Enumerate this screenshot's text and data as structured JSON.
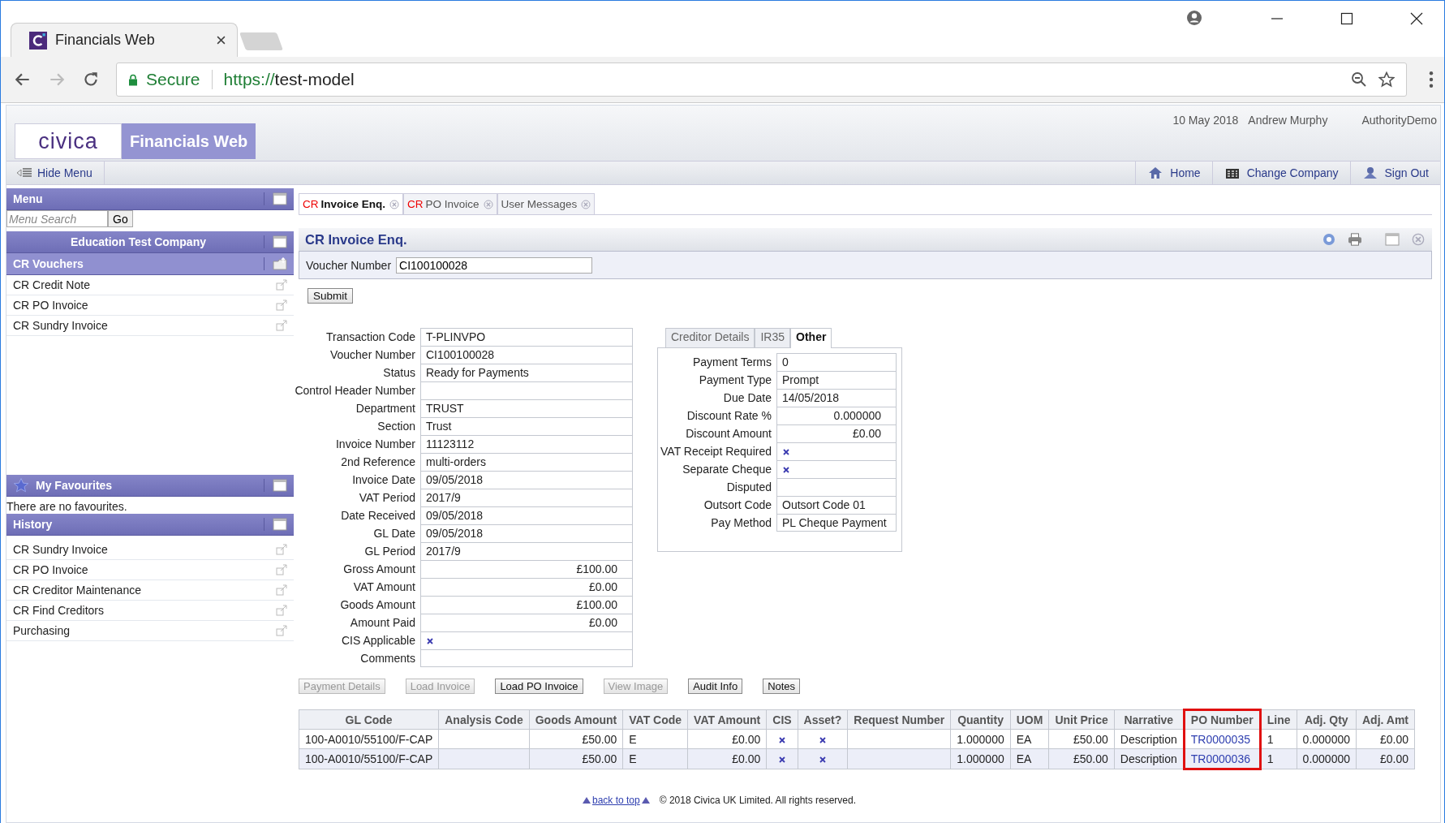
{
  "browser": {
    "tab_title": "Financials Web",
    "secure_label": "Secure",
    "url_scheme": "https://",
    "url_host": "test-model"
  },
  "header": {
    "logo": "civica",
    "product": "Financials Web",
    "date": "10 May 2018",
    "user": "Andrew Murphy",
    "company": "AuthorityDemo"
  },
  "nav": {
    "hide_menu": "Hide Menu",
    "links": [
      {
        "kind": "home",
        "label": "Home"
      },
      {
        "kind": "company",
        "label": "Change Company"
      },
      {
        "kind": "signout",
        "label": "Sign Out"
      }
    ]
  },
  "sidebar": {
    "menu_title": "Menu",
    "search_placeholder": "Menu Search",
    "go": "Go",
    "company": "Education Test Company",
    "section": {
      "title": "CR Vouchers",
      "items": [
        "CR Credit Note",
        "CR PO Invoice",
        "CR Sundry Invoice"
      ]
    },
    "favourites": {
      "title": "My Favourites",
      "empty": "There are no favourites."
    },
    "history": {
      "title": "History",
      "items": [
        "CR Sundry Invoice",
        "CR PO Invoice",
        "CR Creditor Maintenance",
        "CR Find Creditors",
        "Purchasing"
      ]
    }
  },
  "tabs": [
    {
      "prefix": "CR",
      "label": "Invoice Enq.",
      "selected": true
    },
    {
      "prefix": "CR",
      "label": "PO Invoice",
      "selected": false
    },
    {
      "label": "User Messages",
      "selected": false
    }
  ],
  "page_title": "CR Invoice Enq.",
  "voucher": {
    "label": "Voucher Number",
    "value": "CI100100028"
  },
  "submit": "Submit",
  "fields": [
    {
      "label": "Transaction Code",
      "kind": "text",
      "value": "T-PLINVPO"
    },
    {
      "label": "Voucher Number",
      "kind": "text",
      "value": "CI100100028"
    },
    {
      "label": "Status",
      "kind": "text",
      "value": "Ready for Payments"
    },
    {
      "label": "Control Header Number",
      "kind": "text"
    },
    {
      "label": "Department",
      "kind": "text",
      "value": "TRUST"
    },
    {
      "label": "Section",
      "kind": "text",
      "value": "Trust"
    },
    {
      "label": "Invoice Number",
      "kind": "text",
      "value": "11123112"
    },
    {
      "label": "2nd Reference",
      "kind": "text",
      "value": "multi-orders"
    },
    {
      "label": "Invoice Date",
      "kind": "text",
      "value": "09/05/2018"
    },
    {
      "label": "VAT Period",
      "kind": "text",
      "value": "2017/9"
    },
    {
      "label": "Date Received",
      "kind": "text",
      "value": "09/05/2018"
    },
    {
      "label": "GL Date",
      "kind": "text",
      "value": "09/05/2018"
    },
    {
      "label": "GL Period",
      "kind": "text",
      "value": "2017/9"
    },
    {
      "label": "Gross Amount",
      "kind": "amount",
      "value": "£100.00"
    },
    {
      "label": "VAT Amount",
      "kind": "amount",
      "value": "£0.00"
    },
    {
      "label": "Goods Amount",
      "kind": "amount",
      "value": "£100.00"
    },
    {
      "label": "Amount Paid",
      "kind": "amount",
      "value": "£0.00"
    },
    {
      "label": "CIS Applicable",
      "kind": "check",
      "checked": true
    },
    {
      "label": "Comments",
      "kind": "text"
    }
  ],
  "detail_tabs": [
    {
      "label": "Creditor Details",
      "selected": false
    },
    {
      "label": "IR35",
      "selected": false
    },
    {
      "label": "Other",
      "selected": true
    }
  ],
  "other_fields": [
    {
      "label": "Payment Terms",
      "kind": "text",
      "value": "0"
    },
    {
      "label": "Payment Type",
      "kind": "text",
      "value": "Prompt"
    },
    {
      "label": "Due Date",
      "kind": "text",
      "value": "14/05/2018"
    },
    {
      "label": "Discount Rate %",
      "kind": "amount",
      "value": "0.000000"
    },
    {
      "label": "Discount Amount",
      "kind": "amount",
      "value": "£0.00"
    },
    {
      "label": "VAT Receipt Required",
      "kind": "check",
      "checked": true
    },
    {
      "label": "Separate Cheque",
      "kind": "check",
      "checked": true
    },
    {
      "label": "Disputed",
      "kind": "check",
      "checked": false
    },
    {
      "label": "Outsort Code",
      "kind": "text",
      "value": "Outsort Code 01"
    },
    {
      "label": "Pay Method",
      "kind": "text",
      "value": "PL Cheque Payment"
    }
  ],
  "buttons": [
    {
      "label": "Payment Details",
      "disabled": true
    },
    {
      "label": "Load Invoice",
      "disabled": true
    },
    {
      "label": "Load PO Invoice",
      "disabled": false
    },
    {
      "label": "View Image",
      "disabled": true
    },
    {
      "label": "Audit Info",
      "disabled": false
    },
    {
      "label": "Notes",
      "disabled": false
    }
  ],
  "table": {
    "columns": [
      {
        "label": "GL Code",
        "kind": "text",
        "highlighted": false
      },
      {
        "label": "Analysis Code",
        "kind": "text",
        "highlighted": false
      },
      {
        "label": "Goods Amount",
        "kind": "amount",
        "highlighted": false
      },
      {
        "label": "VAT Code",
        "kind": "text",
        "highlighted": false
      },
      {
        "label": "VAT Amount",
        "kind": "amount",
        "highlighted": false
      },
      {
        "label": "CIS",
        "kind": "check",
        "highlighted": false
      },
      {
        "label": "Asset?",
        "kind": "check",
        "highlighted": false
      },
      {
        "label": "Request Number",
        "kind": "text",
        "highlighted": false
      },
      {
        "label": "Quantity",
        "kind": "amount",
        "highlighted": false
      },
      {
        "label": "UOM",
        "kind": "text",
        "highlighted": false
      },
      {
        "label": "Unit Price",
        "kind": "amount",
        "highlighted": false
      },
      {
        "label": "Narrative",
        "kind": "text",
        "highlighted": false
      },
      {
        "label": "PO Number",
        "kind": "link",
        "highlighted": true
      },
      {
        "label": "Line",
        "kind": "text",
        "highlighted": false
      },
      {
        "label": "Adj. Qty",
        "kind": "amount",
        "highlighted": false
      },
      {
        "label": "Adj. Amt",
        "kind": "amount",
        "highlighted": false
      }
    ],
    "rows": [
      {
        "cells": [
          "100-A0010/55100/F-CAP",
          null,
          "£50.00",
          "E",
          "£0.00",
          true,
          true,
          null,
          "1.000000",
          "EA",
          "£50.00",
          "Description",
          "TR0000035",
          "1",
          "0.000000",
          "£0.00"
        ]
      },
      {
        "cells": [
          "100-A0010/55100/F-CAP",
          null,
          "£50.00",
          "E",
          "£0.00",
          true,
          true,
          null,
          "1.000000",
          "EA",
          "£50.00",
          "Description",
          "TR0000036",
          "1",
          "0.000000",
          "£0.00"
        ]
      }
    ]
  },
  "footer": {
    "back_to_top": "back to top",
    "copyright": "© 2018 Civica UK Limited. All rights reserved."
  }
}
